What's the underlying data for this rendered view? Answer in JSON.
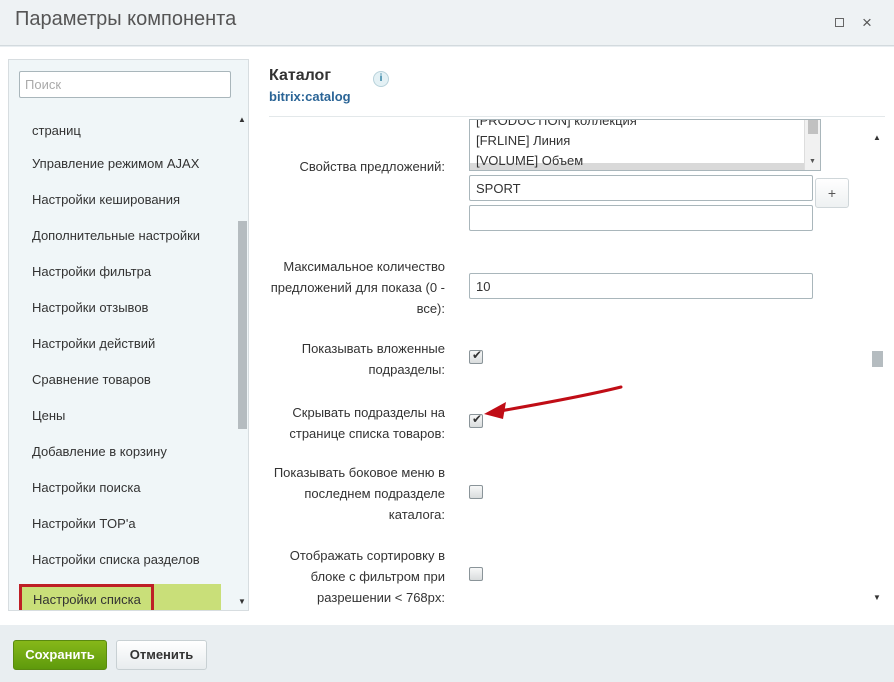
{
  "window": {
    "title": "Параметры компонента",
    "minimize_icon": "minimize-icon",
    "close_glyph": "×"
  },
  "sidebar": {
    "search_placeholder": "Поиск",
    "partial_top_label": "страниц",
    "items": [
      "Управление режимом AJAX",
      "Настройки кеширования",
      "Дополнительные настройки",
      "Настройки фильтра",
      "Настройки отзывов",
      "Настройки действий",
      "Сравнение товаров",
      "Цены",
      "Добавление в корзину",
      "Настройки поиска",
      "Настройки TOP'а",
      "Настройки списка разделов"
    ],
    "active_item": "Настройки списка",
    "active_color": "#c9df79",
    "highlight_color": "#be1f26"
  },
  "component": {
    "title": "Каталог",
    "code": "bitrix:catalog",
    "info_glyph": "i"
  },
  "params": {
    "offer_props_label": "Свойства предложений:",
    "offer_props_options": [
      "[PRODUCTION] коллекция",
      "[FRLINE] Линия",
      "[VOLUME] Объем"
    ],
    "offer_props_field1": "SPORT",
    "offer_props_field2": "",
    "plus_label": "+",
    "max_offers_label": "Максимальное количество предложений для показа (0 - все):",
    "max_offers_value": "10",
    "show_sub_label": "Показывать вложенные подразделы:",
    "show_sub_checked": true,
    "hide_sub_label": "Скрывать подразделы на странице списка товаров:",
    "hide_sub_checked": true,
    "side_menu_label": "Показывать боковое меню в последнем подразделе каталога:",
    "side_menu_checked": false,
    "sort_label": "Отображать сортировку в блоке с фильтром при разрешении < 768px:",
    "sort_checked": false,
    "check_glyph": "✔"
  },
  "footer": {
    "save_label": "Сохранить",
    "cancel_label": "Отменить"
  },
  "annotation": {
    "arrow_color": "#c00d16"
  }
}
